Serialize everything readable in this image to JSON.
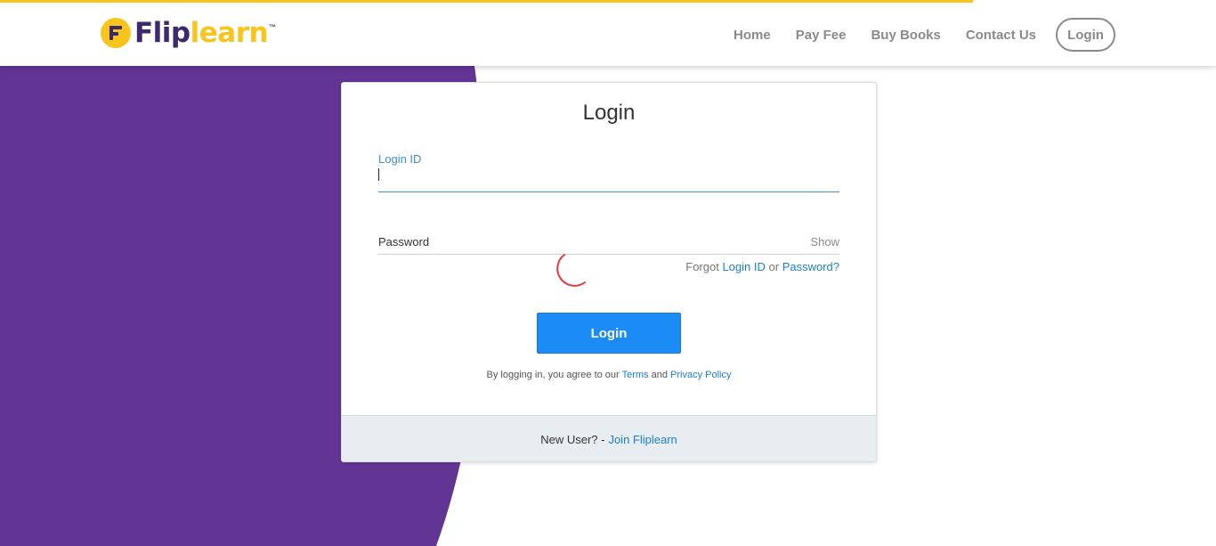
{
  "colors": {
    "brand_purple": "#623594",
    "brand_yellow": "#f7c51c",
    "link_blue": "#1a7fd4",
    "button_blue": "#1b8bf5",
    "spinner_red": "#e23b3b"
  },
  "header": {
    "logo": {
      "icon": "fliplearn-f-icon",
      "text_part1": "Flip",
      "text_part2": "learn",
      "trademark": "™"
    },
    "nav": {
      "home": "Home",
      "pay_fee": "Pay Fee",
      "buy_books": "Buy Books",
      "contact_us": "Contact Us",
      "login": "Login"
    }
  },
  "login_card": {
    "title": "Login",
    "login_id": {
      "label": "Login ID",
      "value": ""
    },
    "password": {
      "label": "Password",
      "toggle": "Show"
    },
    "forgot": {
      "prefix": "Forgot",
      "login_id_link": "Login ID",
      "or": "or",
      "password_link": "Password?"
    },
    "loading_icon": "spinner-icon",
    "submit_label": "Login",
    "agreement": {
      "prefix": "By logging in, you agree to our",
      "terms": "Terms",
      "and": "and",
      "privacy": "Privacy Policy"
    },
    "footer": {
      "prompt": "New User? -",
      "join_link": "Join Fliplearn"
    }
  }
}
